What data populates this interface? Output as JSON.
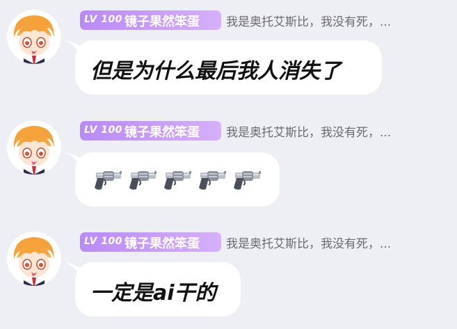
{
  "messages": [
    {
      "sender": {
        "level": "LV 100",
        "name": "镜子果然笨蛋",
        "status": "我是奥托艾斯比，我没有死，..."
      },
      "text": "但是为什么最后我人消失了"
    },
    {
      "sender": {
        "level": "LV 100",
        "name": "镜子果然笨蛋",
        "status": "我是奥托艾斯比，我没有死，..."
      },
      "icons": [
        "revolver-icon",
        "revolver-icon",
        "revolver-icon",
        "revolver-icon",
        "revolver-icon"
      ]
    },
    {
      "sender": {
        "level": "LV 100",
        "name": "镜子果然笨蛋",
        "status": "我是奥托艾斯比，我没有死，..."
      },
      "text": "一定是ai干的"
    }
  ],
  "colors": {
    "background": "#eeeff4",
    "bubble": "#ffffff",
    "badge_gradient_start": "#b98af6",
    "badge_gradient_end": "#d6b0f8",
    "status_text": "#6a6a6e"
  }
}
